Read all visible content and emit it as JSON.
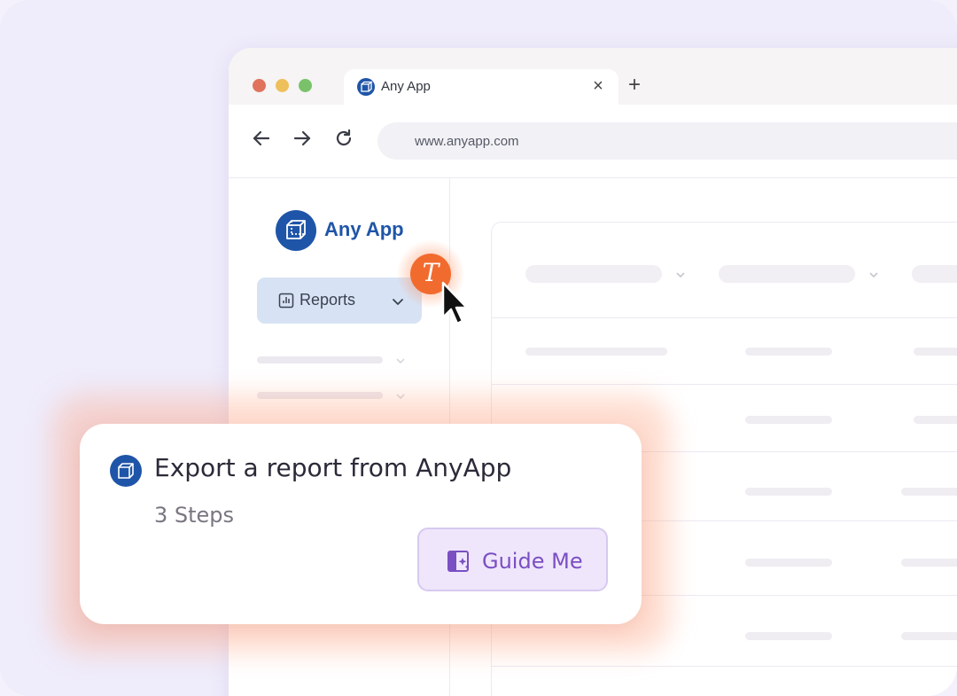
{
  "browser": {
    "tab": {
      "title": "Any App",
      "icon": "cube-icon",
      "close_symbol": "×"
    },
    "new_tab_symbol": "+",
    "nav": {
      "back_icon": "arrow-left-icon",
      "forward_icon": "arrow-right-icon",
      "reload_icon": "reload-icon"
    },
    "url": "www.anyapp.com"
  },
  "sidebar": {
    "app_name": "Any App",
    "logo_icon": "cube-icon",
    "reports": {
      "label": "Reports",
      "icon": "bar-chart-icon",
      "chevron": "chevron-down-icon"
    }
  },
  "cursor_badge": {
    "letter": "T",
    "color": "#f26b2e"
  },
  "guide": {
    "title": "Export a report from AnyApp",
    "steps": "3 Steps",
    "button_label": "Guide Me",
    "button_icon": "sparkle-doc-icon"
  },
  "colors": {
    "brand_blue": "#1f55a8",
    "guide_purple": "#7a4fc2",
    "accent_orange": "#f26b2e"
  }
}
